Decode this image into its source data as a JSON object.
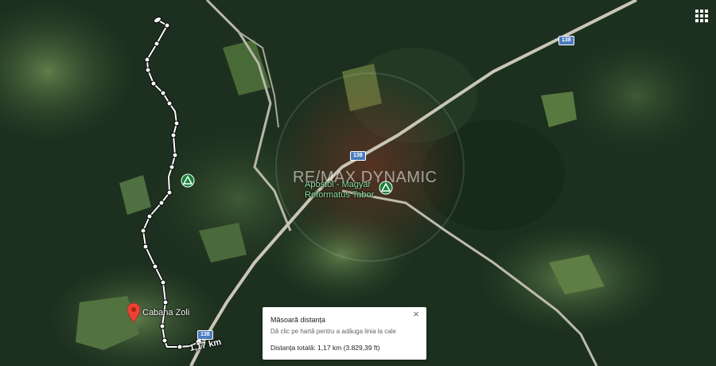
{
  "map": {
    "watermark": "RE/MAX DYNAMIC",
    "road_shields": [
      "138",
      "138",
      "138"
    ],
    "places": {
      "cabana": "Cabana Zoli",
      "tabor": "Apostol - Magyar\nReformatus Tabor"
    },
    "distance_label": "1,17 km",
    "icons": {
      "apps": "apps-grid-icon",
      "pin": "map-pin-icon",
      "campground": "campground-icon",
      "close": "close-icon"
    }
  },
  "measure_panel": {
    "title": "Măsoară distanța",
    "hint": "Dă clic pe hartă pentru a adăuga linia la cale",
    "total": "Distanța totală: 1,17 km (3.829,39 ft)",
    "close_glyph": "×"
  }
}
